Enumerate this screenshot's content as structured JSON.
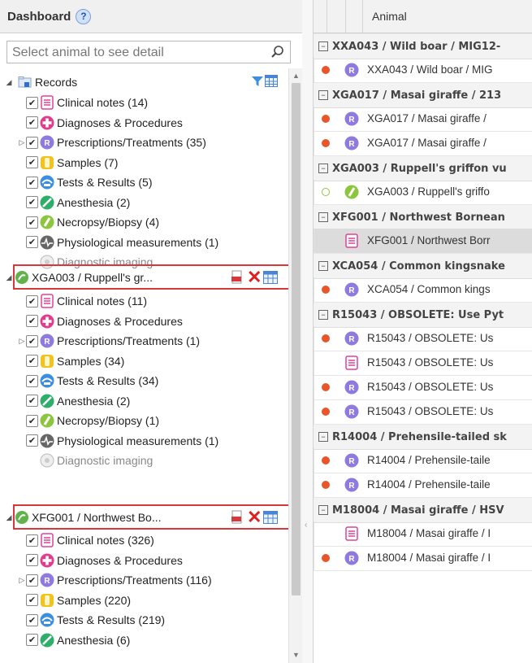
{
  "left": {
    "title": "Dashboard",
    "help_icon": "?",
    "search_placeholder": "Select animal to see detail",
    "records_label": "Records",
    "tree": [
      {
        "label": "Clinical notes (14)",
        "icon": "clinical-notes-icon"
      },
      {
        "label": "Diagnoses & Procedures",
        "icon": "diagnoses-icon"
      },
      {
        "label": "Prescriptions/Treatments (35)",
        "icon": "prescription-icon",
        "expandable": true
      },
      {
        "label": "Samples (7)",
        "icon": "samples-icon"
      },
      {
        "label": "Tests & Results (5)",
        "icon": "tests-icon"
      },
      {
        "label": "Anesthesia (2)",
        "icon": "anesthesia-icon"
      },
      {
        "label": "Necropsy/Biopsy (4)",
        "icon": "necropsy-icon"
      },
      {
        "label": "Physiological measurements (1)",
        "icon": "physio-icon"
      },
      {
        "label": "Diagnostic imaging",
        "icon": "imaging-icon",
        "greyed": true
      }
    ],
    "animal1": {
      "label": "XGA003 / Ruppell's gr...",
      "tree": [
        {
          "label": "Clinical notes (11)"
        },
        {
          "label": "Diagnoses & Procedures"
        },
        {
          "label": "Prescriptions/Treatments (1)",
          "expandable": true
        },
        {
          "label": "Samples (34)"
        },
        {
          "label": "Tests & Results (34)"
        },
        {
          "label": "Anesthesia (2)"
        },
        {
          "label": "Necropsy/Biopsy (1)"
        },
        {
          "label": "Physiological measurements (1)"
        },
        {
          "label": "Diagnostic imaging",
          "greyed": true
        }
      ]
    },
    "animal2": {
      "label": "XFG001 / Northwest Bo...",
      "tree": [
        {
          "label": "Clinical notes (326)"
        },
        {
          "label": "Diagnoses & Procedures"
        },
        {
          "label": "Prescriptions/Treatments (116)",
          "expandable": true
        },
        {
          "label": "Samples (220)"
        },
        {
          "label": "Tests & Results (219)"
        },
        {
          "label": "Anesthesia (6)"
        }
      ]
    }
  },
  "grid": {
    "column_animal": "Animal",
    "rows": [
      {
        "kind": "group",
        "text": "XXA043 / Wild boar / MIG12-"
      },
      {
        "kind": "data",
        "dot": "#e8552a",
        "icon": "rx",
        "text": "XXA043 / Wild boar / MIG"
      },
      {
        "kind": "group",
        "text": "XGA017 / Masai giraffe / 213"
      },
      {
        "kind": "data",
        "dot": "#e8552a",
        "icon": "rx",
        "text": "XGA017 / Masai giraffe /"
      },
      {
        "kind": "data",
        "dot": "#e8552a",
        "icon": "rx",
        "text": "XGA017 / Masai giraffe /"
      },
      {
        "kind": "group",
        "text": "XGA003 / Ruppell's griffon vu"
      },
      {
        "kind": "data",
        "dot": "hollow",
        "icon": "necropsy",
        "text": "XGA003 / Ruppell's griffo"
      },
      {
        "kind": "group",
        "text": "XFG001 / Northwest Bornean"
      },
      {
        "kind": "data",
        "dot": "none",
        "icon": "notes",
        "text": "XFG001 / Northwest Borr",
        "selected": true
      },
      {
        "kind": "group",
        "text": "XCA054 / Common kingsnake"
      },
      {
        "kind": "data",
        "dot": "#e8552a",
        "icon": "rx",
        "text": "XCA054 / Common kings"
      },
      {
        "kind": "group",
        "text": "R15043 / OBSOLETE: Use Pyt"
      },
      {
        "kind": "data",
        "dot": "#e8552a",
        "icon": "rx",
        "text": "R15043 / OBSOLETE: Us"
      },
      {
        "kind": "data",
        "dot": "none",
        "icon": "notes",
        "text": "R15043 / OBSOLETE: Us"
      },
      {
        "kind": "data",
        "dot": "#e8552a",
        "icon": "rx",
        "text": "R15043 / OBSOLETE: Us"
      },
      {
        "kind": "data",
        "dot": "#e8552a",
        "icon": "rx",
        "text": "R15043 / OBSOLETE: Us"
      },
      {
        "kind": "group",
        "text": "R14004 / Prehensile-tailed sk"
      },
      {
        "kind": "data",
        "dot": "#e8552a",
        "icon": "rx",
        "text": "R14004 / Prehensile-taile"
      },
      {
        "kind": "data",
        "dot": "#e8552a",
        "icon": "rx",
        "text": "R14004 / Prehensile-taile"
      },
      {
        "kind": "group",
        "text": "M18004 / Masai giraffe / HSV"
      },
      {
        "kind": "data",
        "dot": "none",
        "icon": "notes",
        "text": "M18004 / Masai giraffe / I"
      },
      {
        "kind": "data",
        "dot": "#e8552a",
        "icon": "rx",
        "text": "M18004 / Masai giraffe / I"
      }
    ]
  },
  "colors": {
    "highlight_box": "#d9373c",
    "status_dot": "#e8552a",
    "selected_row": "#dcdcdc"
  }
}
